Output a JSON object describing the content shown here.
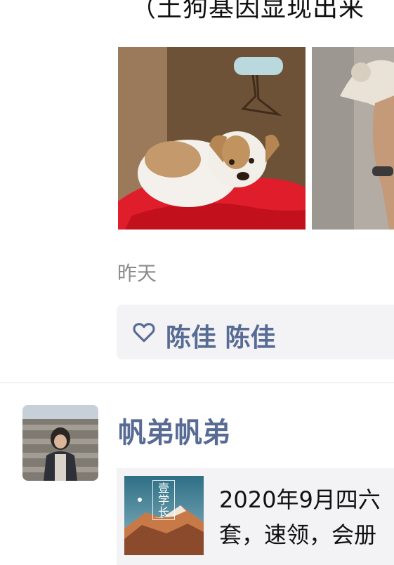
{
  "post": {
    "text_partial": "（土狗基因显现出来",
    "photos": [
      {
        "icon": "puppy-photo"
      },
      {
        "icon": "dog-photo"
      }
    ],
    "timestamp": "昨天",
    "likes": {
      "icon": "heart-outline-icon",
      "names": "陈佳 陈佳"
    }
  },
  "next_post": {
    "username": "帆弟帆弟",
    "avatar": {
      "icon": "avatar-person-photo"
    },
    "share": {
      "thumbnail_title": "壹学长",
      "line1": "2020年9月四六",
      "line2": "套，速领，会册"
    }
  },
  "colors": {
    "name_blue": "#576b95",
    "box_bg": "#f3f3f5",
    "time_gray": "#8b8b8b"
  }
}
